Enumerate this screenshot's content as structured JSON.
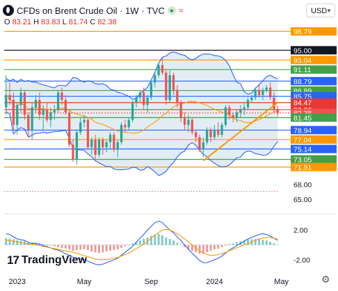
{
  "header": {
    "title": "CFDs on Brent Crude Oil · 1W · TVC",
    "currency": "USD"
  },
  "ohlc": [
    {
      "key": "O",
      "value": "83.21"
    },
    {
      "key": "H",
      "value": "83.83"
    },
    {
      "key": "L",
      "value": "81.74"
    },
    {
      "key": "C",
      "value": "82.38"
    }
  ],
  "brand": "TradingView",
  "colors": {
    "up": "#26a69a",
    "down": "#ef5350",
    "band": "#2962ff",
    "band_fill": "#cfe0ee",
    "ma": "#ff9800",
    "trendline": "#ff9800"
  },
  "chart_data": [
    {
      "type": "candlestick",
      "title": "CFDs on Brent Crude Oil · 1W · TVC",
      "x_labels": [
        {
          "label": "2023",
          "week": 3
        },
        {
          "label": "May",
          "week": 21
        },
        {
          "label": "Sep",
          "week": 39
        },
        {
          "label": "2024",
          "week": 56
        },
        {
          "label": "May",
          "week": 74
        }
      ],
      "y_ticks": [
        68.0,
        65.0
      ],
      "ylim": [
        63.2,
        99.8
      ],
      "price_lines": [
        {
          "label": "98.79",
          "value": 98.79,
          "color": "#ff9800"
        },
        {
          "label": "95.00",
          "value": 95.0,
          "color": "#131722"
        },
        {
          "label": "93.04",
          "value": 93.04,
          "color": "#ff9800"
        },
        {
          "label": "91.11",
          "value": 91.11,
          "color": "#43a047"
        },
        {
          "label": "88.79",
          "value": 88.79,
          "color": "#2962ff"
        },
        {
          "label": "86.89",
          "value": 86.89,
          "color": "#43a047"
        },
        {
          "label": "85.75",
          "value": 85.75,
          "color": "#2962ff"
        },
        {
          "label": "84.47",
          "value": 84.47,
          "color": "#e53935"
        },
        {
          "label": "83.06",
          "value": 83.06,
          "color": "#e53935"
        },
        {
          "label": "82.38",
          "value": 82.38,
          "color": "#ef5350"
        },
        {
          "label": "81.45",
          "value": 81.45,
          "color": "#43a047"
        },
        {
          "label": "78.94",
          "value": 78.94,
          "color": "#2962ff"
        },
        {
          "label": "77.04",
          "value": 77.04,
          "color": "#ff9800"
        },
        {
          "label": "75.14",
          "value": 75.14,
          "color": "#2962ff"
        },
        {
          "label": "73.05",
          "value": 73.05,
          "color": "#43a047"
        },
        {
          "label": "71.51",
          "value": 71.51,
          "color": "#ff9800"
        }
      ],
      "candles": [
        [
          0,
          83.5,
          90.0,
          82.0,
          86.0
        ],
        [
          1,
          86.0,
          88.5,
          84.0,
          85.0
        ],
        [
          2,
          85.0,
          86.5,
          79.0,
          80.0
        ],
        [
          3,
          80.0,
          84.5,
          78.0,
          84.0
        ],
        [
          4,
          84.0,
          87.5,
          82.5,
          86.5
        ],
        [
          5,
          86.5,
          87.0,
          81.0,
          82.0
        ],
        [
          6,
          82.0,
          82.5,
          77.5,
          79.0
        ],
        [
          7,
          79.0,
          84.5,
          77.0,
          83.5
        ],
        [
          8,
          83.5,
          86.0,
          82.5,
          85.0
        ],
        [
          9,
          85.0,
          86.5,
          81.0,
          82.0
        ],
        [
          10,
          82.0,
          84.0,
          79.0,
          83.0
        ],
        [
          11,
          83.0,
          84.5,
          80.5,
          81.0
        ],
        [
          12,
          81.0,
          83.5,
          79.5,
          82.5
        ],
        [
          13,
          82.5,
          84.0,
          81.0,
          83.0
        ],
        [
          14,
          83.0,
          87.0,
          82.5,
          86.5
        ],
        [
          15,
          86.5,
          87.5,
          84.0,
          85.0
        ],
        [
          16,
          85.0,
          86.0,
          82.0,
          82.5
        ],
        [
          17,
          82.5,
          82.8,
          75.5,
          76.0
        ],
        [
          18,
          76.0,
          77.0,
          72.5,
          73.0
        ],
        [
          19,
          73.0,
          79.0,
          72.0,
          78.5
        ],
        [
          20,
          78.5,
          81.5,
          78.0,
          80.5
        ],
        [
          21,
          80.5,
          82.0,
          79.5,
          81.0
        ],
        [
          22,
          81.0,
          81.5,
          75.0,
          75.5
        ],
        [
          23,
          75.5,
          77.5,
          74.0,
          77.0
        ],
        [
          24,
          77.0,
          78.0,
          73.0,
          74.0
        ],
        [
          25,
          74.0,
          77.5,
          73.5,
          77.0
        ],
        [
          26,
          77.0,
          77.5,
          74.0,
          75.5
        ],
        [
          27,
          75.5,
          77.0,
          74.5,
          76.5
        ],
        [
          28,
          76.5,
          78.5,
          75.0,
          78.0
        ],
        [
          29,
          78.0,
          78.5,
          74.5,
          75.0
        ],
        [
          30,
          75.0,
          77.0,
          73.5,
          76.5
        ],
        [
          31,
          76.5,
          80.5,
          76.0,
          80.0
        ],
        [
          32,
          80.0,
          81.0,
          78.5,
          79.5
        ],
        [
          33,
          79.5,
          81.5,
          79.0,
          81.0
        ],
        [
          34,
          81.0,
          85.0,
          80.5,
          84.5
        ],
        [
          35,
          84.5,
          86.0,
          83.5,
          85.5
        ],
        [
          36,
          85.5,
          87.0,
          84.5,
          86.5
        ],
        [
          37,
          86.5,
          87.5,
          83.0,
          84.0
        ],
        [
          38,
          84.0,
          86.0,
          82.5,
          85.5
        ],
        [
          39,
          85.5,
          89.0,
          85.0,
          88.5
        ],
        [
          40,
          88.5,
          90.5,
          87.5,
          90.0
        ],
        [
          41,
          90.0,
          92.5,
          89.5,
          92.0
        ],
        [
          42,
          92.0,
          93.5,
          90.0,
          90.5
        ],
        [
          43,
          90.5,
          91.0,
          84.0,
          85.0
        ],
        [
          44,
          85.0,
          91.0,
          84.5,
          90.0
        ],
        [
          45,
          90.0,
          90.5,
          86.0,
          87.0
        ],
        [
          46,
          87.0,
          88.0,
          83.5,
          84.5
        ],
        [
          47,
          84.5,
          85.0,
          80.5,
          81.5
        ],
        [
          48,
          81.5,
          82.5,
          79.0,
          80.0
        ],
        [
          49,
          80.0,
          82.0,
          78.5,
          81.0
        ],
        [
          50,
          81.0,
          81.5,
          78.0,
          78.5
        ],
        [
          51,
          78.5,
          79.0,
          76.5,
          77.5
        ],
        [
          52,
          77.5,
          78.0,
          74.5,
          75.0
        ],
        [
          53,
          75.0,
          77.5,
          73.5,
          76.5
        ],
        [
          54,
          76.5,
          79.5,
          76.0,
          79.0
        ],
        [
          55,
          79.0,
          79.5,
          76.5,
          77.5
        ],
        [
          56,
          77.5,
          80.0,
          77.0,
          79.0
        ],
        [
          57,
          79.0,
          80.5,
          77.5,
          78.0
        ],
        [
          58,
          78.0,
          80.5,
          77.5,
          80.0
        ],
        [
          59,
          80.0,
          84.0,
          79.5,
          83.5
        ],
        [
          60,
          83.5,
          84.0,
          81.0,
          82.0
        ],
        [
          61,
          82.0,
          82.5,
          80.5,
          81.5
        ],
        [
          62,
          81.5,
          83.0,
          80.5,
          82.5
        ],
        [
          63,
          82.5,
          84.0,
          81.5,
          83.0
        ],
        [
          64,
          83.0,
          84.5,
          82.0,
          83.5
        ],
        [
          65,
          83.5,
          85.5,
          83.0,
          85.0
        ],
        [
          66,
          85.0,
          86.0,
          84.5,
          85.5
        ],
        [
          67,
          85.5,
          87.5,
          85.0,
          87.0
        ],
        [
          68,
          87.0,
          88.0,
          85.5,
          86.0
        ],
        [
          69,
          86.0,
          87.5,
          85.0,
          87.0
        ],
        [
          70,
          87.0,
          88.0,
          86.5,
          87.5
        ],
        [
          71,
          87.5,
          88.5,
          85.0,
          85.5
        ],
        [
          72,
          85.5,
          86.5,
          82.5,
          83.0
        ],
        [
          73,
          83.0,
          83.83,
          81.74,
          82.38
        ]
      ],
      "trendline": [
        [
          53,
          72.8
        ],
        [
          73,
          84.5
        ]
      ]
    },
    {
      "type": "macd",
      "y_ticks": [
        2.0,
        -2.0
      ],
      "ylim": [
        -3.5,
        3.8
      ],
      "histogram": [
        0.9,
        0.85,
        0.75,
        0.6,
        0.55,
        0.5,
        0.4,
        0.3,
        0.3,
        0.2,
        0.1,
        0.05,
        -0.05,
        -0.2,
        -0.3,
        -0.4,
        -0.5,
        -0.6,
        -0.8,
        -0.7,
        -0.65,
        -0.6,
        -0.7,
        -0.9,
        -1.0,
        -1.1,
        -1.0,
        -0.9,
        -0.8,
        -0.7,
        -0.6,
        -0.4,
        -0.2,
        0.0,
        0.2,
        0.4,
        0.6,
        0.8,
        1.0,
        1.2,
        1.4,
        1.5,
        1.3,
        1.0,
        0.8,
        0.6,
        0.3,
        0.0,
        -0.3,
        -0.6,
        -0.8,
        -1.0,
        -1.2,
        -1.2,
        -1.0,
        -0.8,
        -0.6,
        -0.5,
        -0.3,
        -0.1,
        0.1,
        0.2,
        0.35,
        0.5,
        0.6,
        0.7,
        0.75,
        0.8,
        0.8,
        0.7,
        0.6,
        0.4,
        0.2,
        0.05
      ],
      "macd_line": [
        1.5,
        1.4,
        1.1,
        0.8,
        0.7,
        0.6,
        0.3,
        0.2,
        0.2,
        0.1,
        -0.1,
        -0.2,
        -0.4,
        -0.6,
        -0.7,
        -0.9,
        -1.2,
        -1.4,
        -1.7,
        -1.8,
        -1.9,
        -2.0,
        -2.2,
        -2.4,
        -2.6,
        -2.7,
        -2.6,
        -2.4,
        -2.2,
        -2.0,
        -1.8,
        -1.4,
        -1.0,
        -0.6,
        -0.2,
        0.4,
        0.9,
        1.4,
        2.0,
        2.5,
        3.0,
        3.2,
        3.0,
        2.5,
        2.0,
        1.6,
        1.1,
        0.6,
        0.0,
        -0.6,
        -1.1,
        -1.6,
        -2.1,
        -2.4,
        -2.4,
        -2.2,
        -2.0,
        -1.8,
        -1.5,
        -1.1,
        -0.7,
        -0.4,
        -0.1,
        0.2,
        0.5,
        0.8,
        1.0,
        1.2,
        1.4,
        1.5,
        1.4,
        1.2,
        0.9,
        0.6
      ],
      "signal_line": [
        0.6,
        0.6,
        0.5,
        0.4,
        0.3,
        0.2,
        0.1,
        0.05,
        0.0,
        -0.1,
        -0.2,
        -0.3,
        -0.4,
        -0.5,
        -0.6,
        -0.7,
        -0.8,
        -0.9,
        -1.0,
        -1.15,
        -1.3,
        -1.45,
        -1.6,
        -1.75,
        -1.9,
        -2.0,
        -2.0,
        -1.95,
        -1.9,
        -1.8,
        -1.7,
        -1.5,
        -1.3,
        -1.1,
        -0.8,
        -0.5,
        -0.2,
        0.1,
        0.5,
        0.9,
        1.3,
        1.7,
        2.0,
        2.1,
        2.0,
        1.8,
        1.5,
        1.2,
        0.8,
        0.4,
        0.0,
        -0.4,
        -0.8,
        -1.1,
        -1.3,
        -1.4,
        -1.4,
        -1.3,
        -1.2,
        -1.0,
        -0.8,
        -0.6,
        -0.4,
        -0.2,
        0.0,
        0.2,
        0.4,
        0.6,
        0.8,
        0.9,
        1.0,
        1.0,
        0.9,
        0.8
      ]
    }
  ]
}
